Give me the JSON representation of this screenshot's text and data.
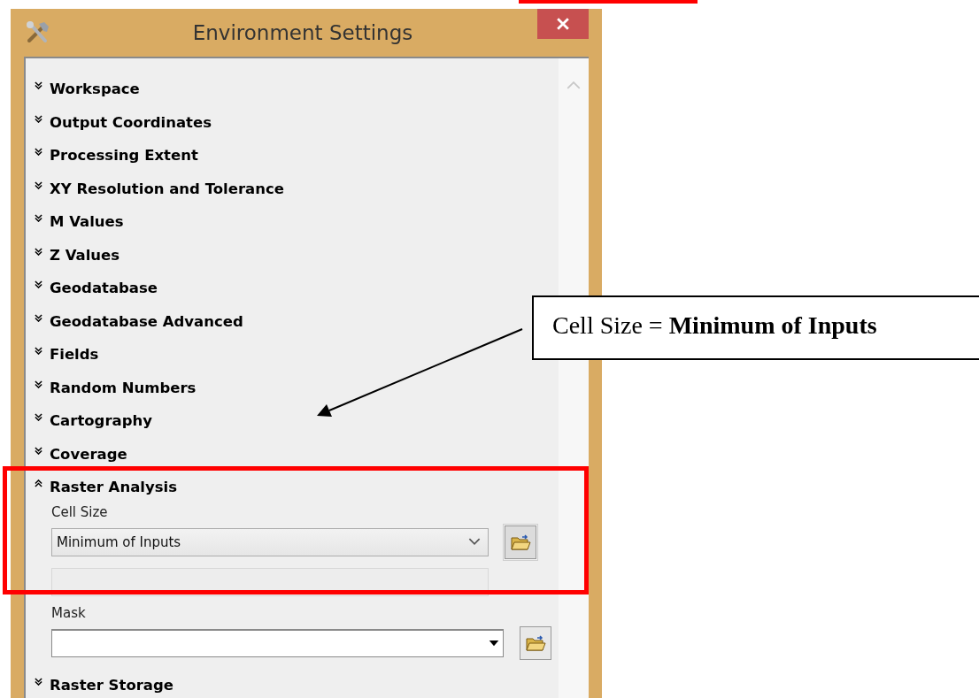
{
  "window": {
    "title": "Environment Settings"
  },
  "sections": [
    {
      "label": "Workspace",
      "expanded": false
    },
    {
      "label": "Output Coordinates",
      "expanded": false
    },
    {
      "label": "Processing Extent",
      "expanded": false
    },
    {
      "label": "XY Resolution and Tolerance",
      "expanded": false
    },
    {
      "label": "M Values",
      "expanded": false
    },
    {
      "label": "Z Values",
      "expanded": false
    },
    {
      "label": "Geodatabase",
      "expanded": false
    },
    {
      "label": "Geodatabase Advanced",
      "expanded": false
    },
    {
      "label": "Fields",
      "expanded": false
    },
    {
      "label": "Random Numbers",
      "expanded": false
    },
    {
      "label": "Cartography",
      "expanded": false
    },
    {
      "label": "Coverage",
      "expanded": false
    },
    {
      "label": "Raster Analysis",
      "expanded": true,
      "fields": [
        {
          "label": "Cell Size",
          "kind": "combo",
          "value": "Minimum of Inputs"
        },
        {
          "label": "Mask",
          "kind": "dropdown"
        }
      ]
    },
    {
      "label": "Raster Storage",
      "expanded": false
    }
  ],
  "callout": {
    "text": "Cell Size = **Minimum of Inputs**"
  }
}
